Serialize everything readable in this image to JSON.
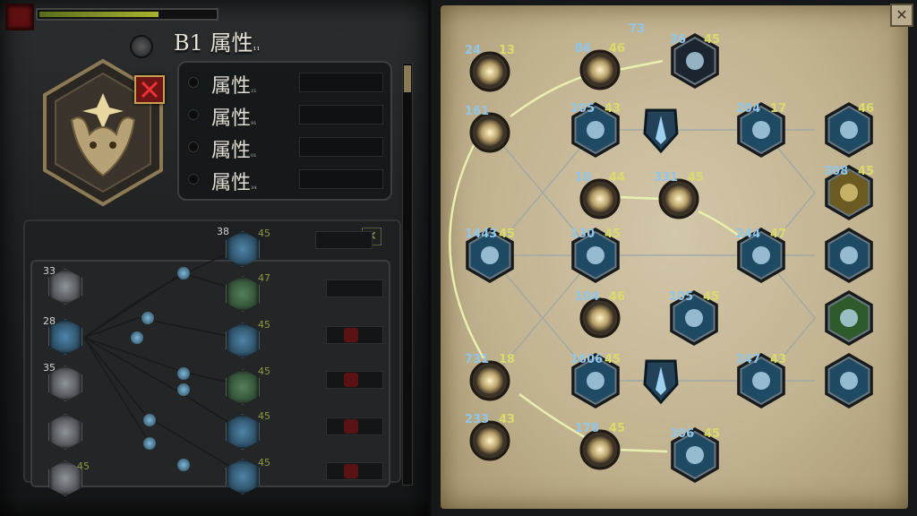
{
  "header": {
    "title": "B1 属性",
    "title_sub": "₁₁",
    "xp_fraction": 0.68
  },
  "stats": [
    {
      "label": "属性",
      "sub": "₂₁"
    },
    {
      "label": "属性",
      "sub": "₉₁"
    },
    {
      "label": "属性",
      "sub": "₀₁"
    },
    {
      "label": "属性",
      "sub": "₃₄"
    }
  ],
  "left_tree": {
    "close_glyph": "✕",
    "left_nums": [
      "33",
      "28",
      "35"
    ],
    "left_num_45": "45",
    "right_nums": [
      {
        "a": "38",
        "b": "45"
      },
      {
        "a": "",
        "b": "47"
      },
      {
        "a": "",
        "b": "45"
      },
      {
        "a": "",
        "b": "45"
      },
      {
        "a": "",
        "b": "45"
      },
      {
        "a": "",
        "b": "45"
      }
    ]
  },
  "skill_tree": {
    "close_glyph": "✕",
    "nodes": [
      {
        "id": "n1",
        "a": "24",
        "b": "13",
        "kind": "orb"
      },
      {
        "id": "n2",
        "a": "86",
        "b": "46",
        "kind": "orb"
      },
      {
        "id": "n3",
        "a": "73",
        "b": "",
        "kind": "none"
      },
      {
        "id": "n4",
        "a": "36",
        "b": "45",
        "kind": "hexdark"
      },
      {
        "id": "n5",
        "a": "161",
        "b": "",
        "kind": "orb"
      },
      {
        "id": "n6",
        "a": "205",
        "b": "43",
        "kind": "hexblue"
      },
      {
        "id": "n7",
        "a": "",
        "b": "",
        "kind": "shield"
      },
      {
        "id": "n8",
        "a": "204",
        "b": "17",
        "kind": "hexblue"
      },
      {
        "id": "n9",
        "a": "",
        "b": "46",
        "kind": "hexblue"
      },
      {
        "id": "n10",
        "a": "10",
        "b": "44",
        "kind": "orb"
      },
      {
        "id": "n11",
        "a": "331",
        "b": "45",
        "kind": "orb"
      },
      {
        "id": "n12",
        "a": "308",
        "b": "45",
        "kind": "hexgold"
      },
      {
        "id": "n13",
        "a": "1443",
        "b": "45",
        "kind": "hexblue"
      },
      {
        "id": "n14",
        "a": "130",
        "b": "45",
        "kind": "hexblue"
      },
      {
        "id": "n15",
        "a": "244",
        "b": "47",
        "kind": "hexblue"
      },
      {
        "id": "n16",
        "a": "",
        "b": "",
        "kind": "hexblue"
      },
      {
        "id": "n17",
        "a": "104",
        "b": "46",
        "kind": "orb"
      },
      {
        "id": "n18",
        "a": "105",
        "b": "45",
        "kind": "hexblue"
      },
      {
        "id": "n19",
        "a": "",
        "b": "",
        "kind": "hexgreen"
      },
      {
        "id": "n20",
        "a": "731",
        "b": "18",
        "kind": "orb"
      },
      {
        "id": "n21",
        "a": "1606",
        "b": "45",
        "kind": "hexblue"
      },
      {
        "id": "n22",
        "a": "",
        "b": "",
        "kind": "shield"
      },
      {
        "id": "n23",
        "a": "247",
        "b": "43",
        "kind": "hexblue"
      },
      {
        "id": "n24",
        "a": "",
        "b": "",
        "kind": "hexblue"
      },
      {
        "id": "n25",
        "a": "233",
        "b": "43",
        "kind": "orb"
      },
      {
        "id": "n26",
        "a": "178",
        "b": "45",
        "kind": "orb"
      },
      {
        "id": "n27",
        "a": "306",
        "b": "45",
        "kind": "hexblue"
      }
    ]
  },
  "colors": {
    "accent_yellow": "#d6d66a",
    "accent_blue": "#7fb6e0",
    "parchment": "#c9bb98",
    "frame_red": "#6d1414"
  }
}
